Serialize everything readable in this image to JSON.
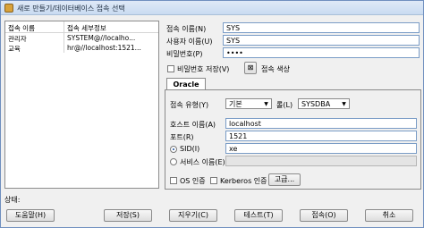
{
  "window": {
    "title": "새로 만들기/데이터베이스 접속 선택"
  },
  "connections": {
    "headers": [
      "접속 이름",
      "접속 세부정보"
    ],
    "rows": [
      {
        "name": "관리자",
        "details": "SYSTEM@//localho..."
      },
      {
        "name": "교육",
        "details": "hr@//localhost:1521..."
      }
    ]
  },
  "form": {
    "connection_name_label": "접속 이름(N)",
    "connection_name_value": "SYS",
    "username_label": "사용자 이름(U)",
    "username_value": "SYS",
    "password_label": "비밀번호(P)",
    "password_value": "••••",
    "save_password_label": "비밀번호 저장(V)",
    "connection_color_label": "접속 색상"
  },
  "tab": {
    "label": "Oracle"
  },
  "oracle": {
    "conn_type_label": "접속 유형(Y)",
    "conn_type_value": "기본",
    "role_label": "롤(L)",
    "role_value": "SYSDBA",
    "hostname_label": "호스트 이름(A)",
    "hostname_value": "localhost",
    "port_label": "포트(R)",
    "port_value": "1521",
    "sid_label": "SID(I)",
    "sid_value": "xe",
    "service_name_label": "서비스 이름(E)",
    "service_name_value": "",
    "os_auth_label": "OS 인증",
    "kerberos_label": "Kerberos 인증",
    "advanced_label": "고급..."
  },
  "status": {
    "label": "상태:"
  },
  "buttons": {
    "help": "도움말(H)",
    "save": "저장(S)",
    "clear": "지우기(C)",
    "test": "테스트(T)",
    "connect": "접속(O)",
    "cancel": "취소"
  }
}
